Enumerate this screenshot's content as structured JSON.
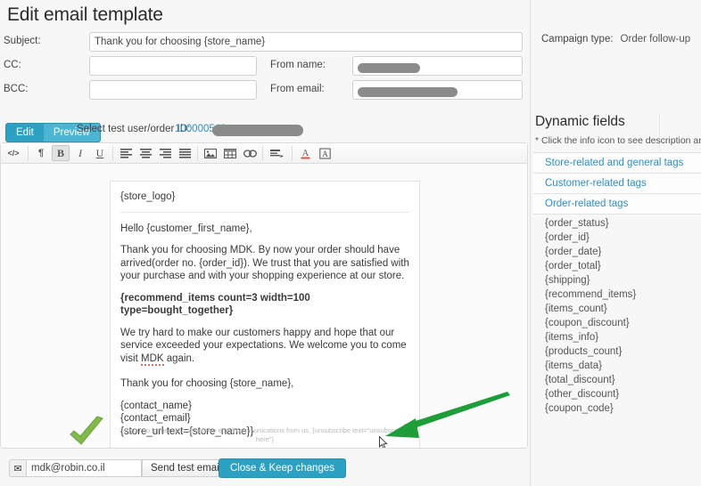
{
  "page": {
    "title": "Edit email template"
  },
  "form": {
    "subject": {
      "label": "Subject:",
      "value": "Thank you for choosing {store_name}"
    },
    "cc": {
      "label": "CC:",
      "value": ""
    },
    "bcc": {
      "label": "BCC:",
      "value": ""
    },
    "from_name": {
      "label": "From name:",
      "value": ""
    },
    "from_email": {
      "label": "From email:",
      "value": ""
    }
  },
  "campaign": {
    "label": "Campaign type:",
    "value": "Order follow-up"
  },
  "tabs": {
    "edit": "Edit",
    "preview": "Preview"
  },
  "test_user": {
    "label": "Select test user/order ID:",
    "value": "100000548"
  },
  "toolbar": {
    "source_code": "</>",
    "paragraph": "¶",
    "bold": "B",
    "italic": "I",
    "underline": "U",
    "align_left": "align-left",
    "align_center": "align-center",
    "align_right": "align-right",
    "align_justify": "align-justify",
    "image": "image",
    "table": "table",
    "link": "link",
    "styles": "styles",
    "text_color": "A",
    "background_color": "A"
  },
  "email_body": {
    "store_logo": "{store_logo}",
    "greeting": "Hello {customer_first_name},",
    "paragraph1": "Thank you for choosing MDK. By now your order should have arrived(order no. {order_id}). We trust that you are satisfied with your purchase and with your shopping experience at our store.",
    "recommend_tag": "{recommend_items count=3 width=100 type=bought_together}",
    "paragraph2_before": "We try hard to make our customers happy and hope that our service exceeded your expectations. We welcome you to come visit ",
    "paragraph2_spell": "MDK",
    "paragraph2_after": " again.",
    "closing": "Thank you for choosing {store_name},",
    "signature_1": "{contact_name}",
    "signature_2": "{contact_email}",
    "signature_3": "{store_url text={store_name}}",
    "footer": "If you no longer wish to receive email communications from us, {unsubscribe text=\"unsubscribe here\"}"
  },
  "dynamic_fields": {
    "title": "Dynamic fields",
    "note": "* Click the info icon to see description and",
    "accordions": [
      "Store-related and general tags",
      "Customer-related tags",
      "Order-related tags"
    ],
    "tags": [
      "{order_status}",
      "{order_id}",
      "{order_date}",
      "{order_total}",
      "{shipping}",
      "{recommend_items}",
      "{items_count}",
      "{coupon_discount}",
      "{items_info}",
      "{products_count}",
      "{items_data}",
      "{total_discount}",
      "{other_discount}",
      "{coupon_code}"
    ]
  },
  "bottom": {
    "mail_icon": "✉",
    "test_email": "mdk@robin.co.il",
    "send_label": "Send test email",
    "close_label": "Close & Keep changes"
  },
  "colors": {
    "accent": "#2da1c4",
    "link": "#2d8fc6",
    "annotation_green": "#1e9e3a",
    "check_green": "#7fba4a"
  }
}
